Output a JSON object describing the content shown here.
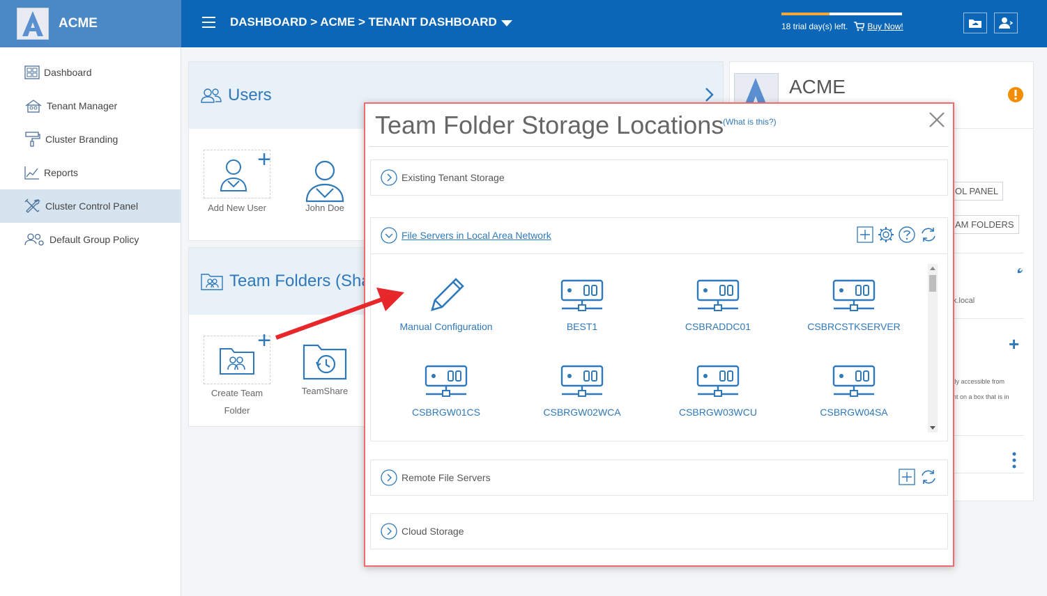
{
  "brand": {
    "name": "ACME",
    "logo_letter": "A"
  },
  "header": {
    "breadcrumb": "DASHBOARD > ACME > TENANT DASHBOARD",
    "trial_text": "18 trial day(s) left.",
    "buy_label": "Buy Now!",
    "trial_progress": 0.4
  },
  "sidebar": {
    "items": [
      {
        "label": "Dashboard",
        "icon": "dashboard-icon"
      },
      {
        "label": "Tenant Manager",
        "icon": "tenant-manager-icon"
      },
      {
        "label": "Cluster Branding",
        "icon": "paint-roller-icon"
      },
      {
        "label": "Reports",
        "icon": "chart-icon"
      },
      {
        "label": "Cluster Control Panel",
        "icon": "tools-icon",
        "active": true
      },
      {
        "label": "Default Group Policy",
        "icon": "group-policy-icon"
      }
    ]
  },
  "users_card": {
    "title": "Users",
    "tiles": [
      {
        "label": "Add New User"
      },
      {
        "label": "John Doe"
      }
    ]
  },
  "team_folders_card": {
    "title": "Team Folders (Sha",
    "tiles": [
      {
        "label": "Create Team Folder"
      },
      {
        "label": "TeamShare"
      }
    ]
  },
  "tenant_card": {
    "name": "ACME",
    "pill_control_panel": "OL PANEL",
    "pill_team_folders": "AM FOLDERS",
    "domain_text": "k.local",
    "note_line1": "tly accessible from",
    "note_line2": "nt on a box that is in"
  },
  "dialog": {
    "title": "Team Folder Storage Locations",
    "help_link": "(What is this?)",
    "sections": {
      "existing": "Existing Tenant Storage",
      "lan": "File Servers in Local Area Network",
      "remote": "Remote File Servers",
      "cloud": "Cloud Storage"
    },
    "servers": [
      {
        "label": "Manual Configuration",
        "icon": "pencil-icon"
      },
      {
        "label": "BEST1",
        "icon": "server-icon"
      },
      {
        "label": "CSBRADDC01",
        "icon": "server-icon"
      },
      {
        "label": "CSBRCSTKSERVER",
        "icon": "server-icon"
      },
      {
        "label": "CSBRGW01CS",
        "icon": "server-icon"
      },
      {
        "label": "CSBRGW02WCA",
        "icon": "server-icon"
      },
      {
        "label": "CSBRGW03WCU",
        "icon": "server-icon"
      },
      {
        "label": "CSBRGW04SA",
        "icon": "server-icon"
      }
    ]
  },
  "colors": {
    "primary": "#0b66b7",
    "accent_blue": "#2f79ba",
    "alert": "#f28c00",
    "dialog_border": "#ef6b6e",
    "arrow": "#e8272a"
  }
}
